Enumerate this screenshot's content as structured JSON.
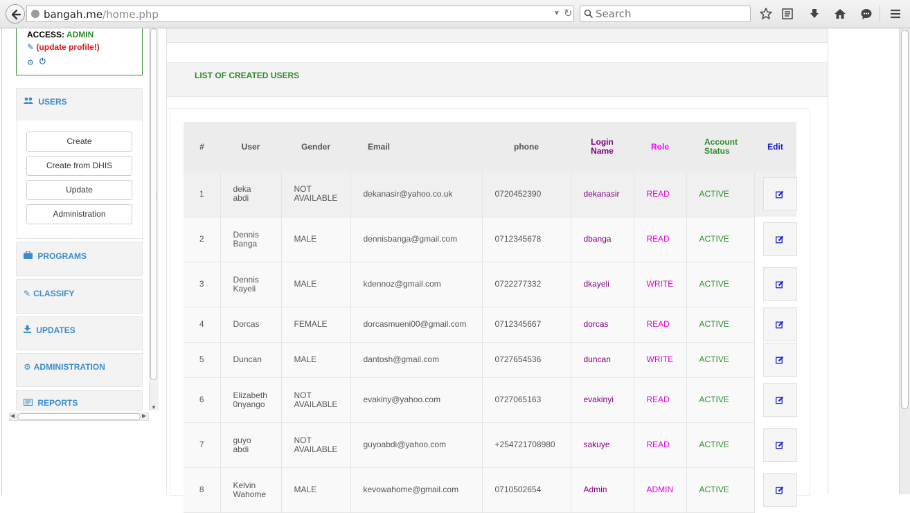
{
  "browser": {
    "url_domain": "bangah.me",
    "url_path": "/home.php",
    "search_placeholder": "Search"
  },
  "sidebar": {
    "access_label": "ACCESS:",
    "access_value": "ADMIN",
    "update_profile": "(update profile!)",
    "users_section": {
      "title": "USERS",
      "buttons": [
        "Create",
        "Create from DHIS",
        "Update",
        "Administration"
      ]
    },
    "sections": [
      "PROGRAMS",
      "CLASSIFY",
      "UPDATES",
      "ADMINISTRATION",
      "REPORTS"
    ]
  },
  "main": {
    "list_title": "LIST OF CREATED USERS",
    "table": {
      "headers": {
        "num": "#",
        "user": "User",
        "gender": "Gender",
        "email": "Email",
        "phone": "phone",
        "login": "Login Name",
        "role": "Role",
        "status": "Account Status",
        "edit": "Edit"
      },
      "rows": [
        {
          "num": "1",
          "user": "deka abdi",
          "gender": "NOT AVAILABLE",
          "email": "dekanasir@yahoo.co.uk",
          "phone": "0720452390",
          "login": "dekanasir",
          "role": "READ",
          "status": "ACTIVE"
        },
        {
          "num": "2",
          "user": "Dennis Banga",
          "gender": "MALE",
          "email": "dennisbanga@gmail.com",
          "phone": "0712345678",
          "login": "dbanga",
          "role": "READ",
          "status": "ACTIVE"
        },
        {
          "num": "3",
          "user": "Dennis Kayeli",
          "gender": "MALE",
          "email": "kdennoz@gmail.com",
          "phone": "0722277332",
          "login": "dkayeli",
          "role": "WRITE",
          "status": "ACTIVE"
        },
        {
          "num": "4",
          "user": "Dorcas",
          "gender": "FEMALE",
          "email": "dorcasmueni00@gmail.com",
          "phone": "0712345667",
          "login": "dorcas",
          "role": "READ",
          "status": "ACTIVE"
        },
        {
          "num": "5",
          "user": "Duncan",
          "gender": "MALE",
          "email": "dantosh@gmail.com",
          "phone": "0727654536",
          "login": "duncan",
          "role": "WRITE",
          "status": "ACTIVE"
        },
        {
          "num": "6",
          "user": "Elizabeth 0nyango",
          "gender": "NOT AVAILABLE",
          "email": "evakiny@yahoo.com",
          "phone": "0727065163",
          "login": "evakinyi",
          "role": "READ",
          "status": "ACTIVE"
        },
        {
          "num": "7",
          "user": "guyo abdi",
          "gender": "NOT AVAILABLE",
          "email": "guyoabdi@yahoo.com",
          "phone": "+254721708980",
          "login": "sakuye",
          "role": "READ",
          "status": "ACTIVE"
        },
        {
          "num": "8",
          "user": "Kelvin Wahome",
          "gender": "MALE",
          "email": "kevowahome@gmail.com",
          "phone": "0710502654",
          "login": "Admin",
          "role": "ADMIN",
          "status": "ACTIVE"
        }
      ]
    }
  }
}
